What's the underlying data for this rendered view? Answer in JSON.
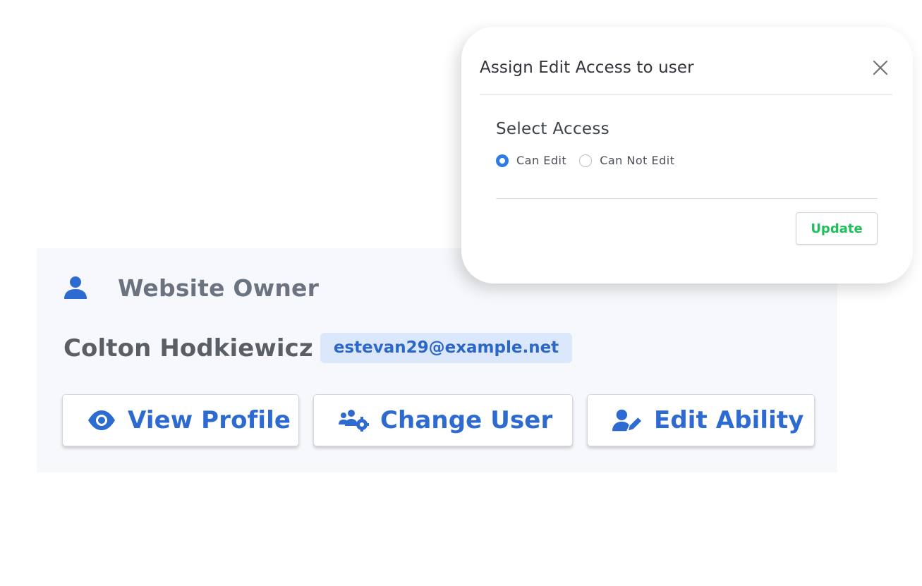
{
  "owner_card": {
    "title": "Website Owner",
    "title_icon": "user-icon",
    "name": "Colton Hodkiewicz",
    "email": "estevan29@example.net",
    "actions": [
      {
        "label": "View Profile",
        "icon": "eye-icon"
      },
      {
        "label": "Change User",
        "icon": "users-gear-icon"
      },
      {
        "label": "Edit Ability",
        "icon": "user-pen-icon"
      }
    ]
  },
  "modal": {
    "title": "Assign Edit Access to user",
    "close_icon": "close-icon",
    "section_label": "Select Access",
    "options": [
      {
        "label": "Can Edit",
        "checked": true
      },
      {
        "label": "Can Not Edit",
        "checked": false
      }
    ],
    "update_label": "Update"
  },
  "colors": {
    "accent_blue": "#2e6bd1",
    "radio_blue": "#2f7be6",
    "update_green": "#1fbf5b",
    "email_badge_bg": "#dbe7fb",
    "card_bg": "#f6f8fc"
  }
}
